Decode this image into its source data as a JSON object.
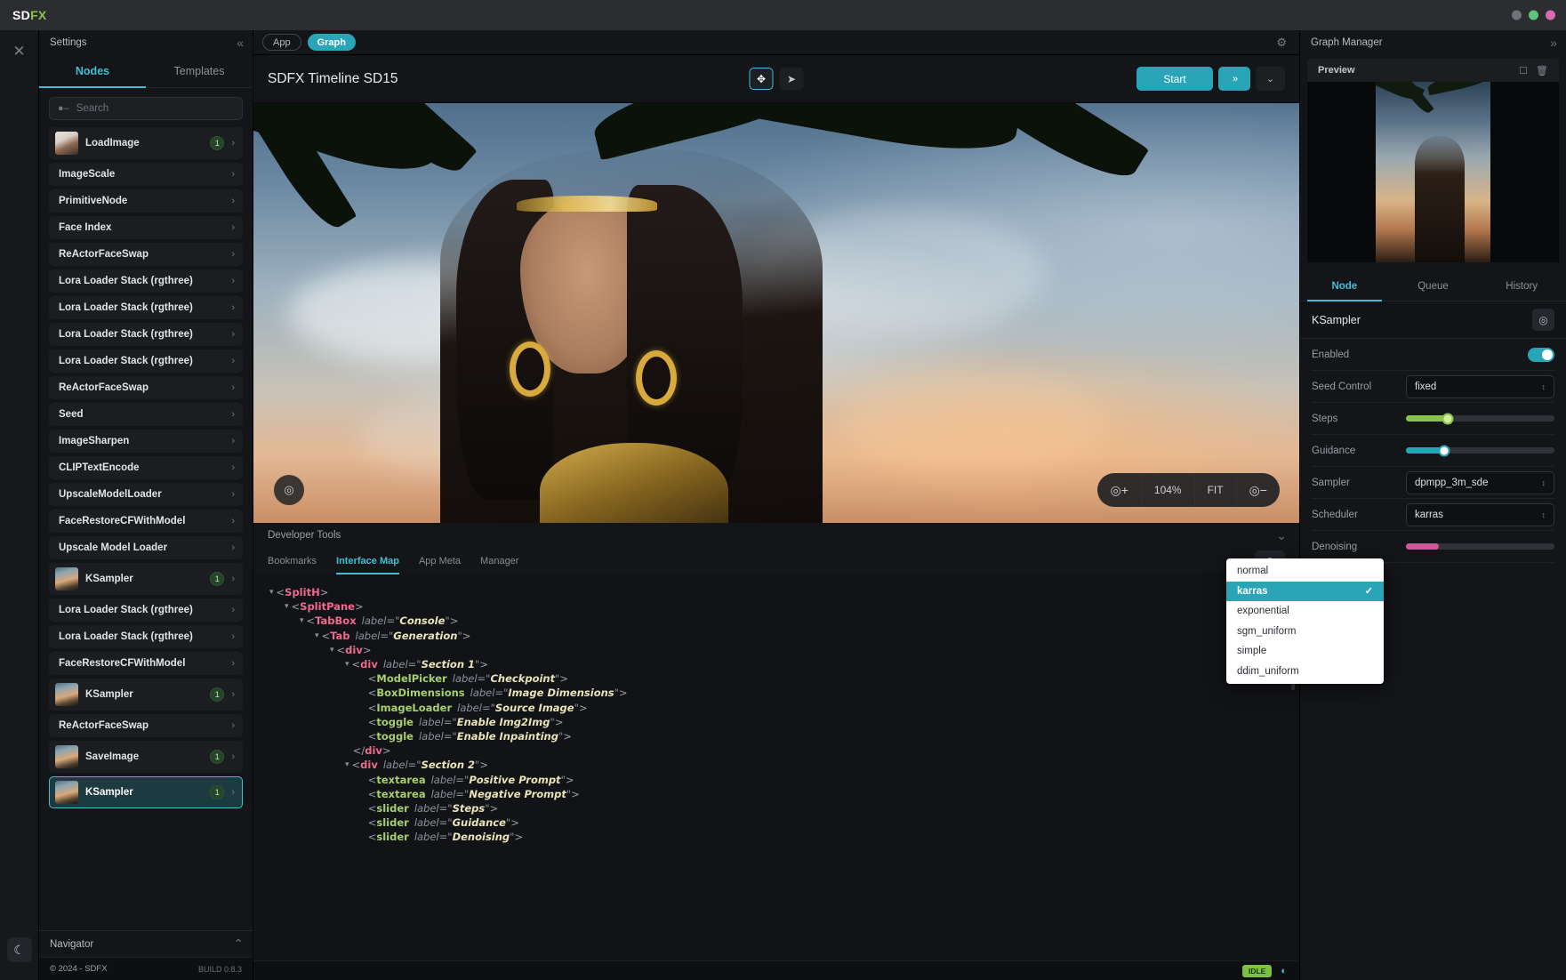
{
  "titlebar": {
    "brand_sd": "SD",
    "brand_fx": "FX"
  },
  "settings": {
    "title": "Settings",
    "tabs": [
      {
        "label": "Nodes"
      },
      {
        "label": "Templates"
      }
    ],
    "search_placeholder": "Search",
    "nodes": [
      {
        "label": "LoadImage",
        "badge": "1",
        "thumb": "face"
      },
      {
        "label": "ImageScale",
        "badge": "",
        "thumb": ""
      },
      {
        "label": "PrimitiveNode",
        "badge": "",
        "thumb": ""
      },
      {
        "label": "Face Index",
        "badge": "",
        "thumb": ""
      },
      {
        "label": "ReActorFaceSwap",
        "badge": "",
        "thumb": ""
      },
      {
        "label": "Lora Loader Stack (rgthree)",
        "badge": "",
        "thumb": ""
      },
      {
        "label": "Lora Loader Stack (rgthree)",
        "badge": "",
        "thumb": ""
      },
      {
        "label": "Lora Loader Stack (rgthree)",
        "badge": "",
        "thumb": ""
      },
      {
        "label": "Lora Loader Stack (rgthree)",
        "badge": "",
        "thumb": ""
      },
      {
        "label": "ReActorFaceSwap",
        "badge": "",
        "thumb": ""
      },
      {
        "label": "Seed",
        "badge": "",
        "thumb": ""
      },
      {
        "label": "ImageSharpen",
        "badge": "",
        "thumb": ""
      },
      {
        "label": "CLIPTextEncode",
        "badge": "",
        "thumb": ""
      },
      {
        "label": "UpscaleModelLoader",
        "badge": "",
        "thumb": ""
      },
      {
        "label": "FaceRestoreCFWithModel",
        "badge": "",
        "thumb": ""
      },
      {
        "label": "Upscale Model Loader",
        "badge": "",
        "thumb": ""
      },
      {
        "label": "KSampler",
        "badge": "1",
        "thumb": "scene"
      },
      {
        "label": "Lora Loader Stack (rgthree)",
        "badge": "",
        "thumb": ""
      },
      {
        "label": "Lora Loader Stack (rgthree)",
        "badge": "",
        "thumb": ""
      },
      {
        "label": "FaceRestoreCFWithModel",
        "badge": "",
        "thumb": ""
      },
      {
        "label": "KSampler",
        "badge": "1",
        "thumb": "scene"
      },
      {
        "label": "ReActorFaceSwap",
        "badge": "",
        "thumb": ""
      },
      {
        "label": "SaveImage",
        "badge": "1",
        "thumb": "scene"
      },
      {
        "label": "KSampler",
        "badge": "1",
        "thumb": "scene",
        "selected": true
      }
    ],
    "navigator_label": "Navigator",
    "copyright": "© 2024 - SDFX",
    "build": "BUILD 0.8.3"
  },
  "center": {
    "tabs": [
      {
        "label": "App",
        "active": false
      },
      {
        "label": "Graph",
        "active": true
      }
    ],
    "canvas_title": "SDFX Timeline SD15",
    "tools": [
      {
        "name": "move-tool",
        "glyph": "✥",
        "active": true
      },
      {
        "name": "pointer-tool",
        "glyph": "➤",
        "active": false
      }
    ],
    "start_label": "Start",
    "queue_more_glyph": "»",
    "dropdown_glyph": "⌄",
    "zoom_percent": "104%",
    "zoom_fit": "FIT"
  },
  "devtools": {
    "title": "Developer Tools",
    "tabs": [
      {
        "label": "Bookmarks",
        "active": false
      },
      {
        "label": "Interface Map",
        "active": true
      },
      {
        "label": "App Meta",
        "active": false
      },
      {
        "label": "Manager",
        "active": false
      }
    ],
    "tree": [
      {
        "indent": 0,
        "caret": true,
        "tag": "SplitH",
        "color": "pink",
        "attr": "",
        "val": "",
        "close": false
      },
      {
        "indent": 1,
        "caret": true,
        "tag": "SplitPane",
        "color": "pink",
        "attr": "",
        "val": "",
        "close": false
      },
      {
        "indent": 2,
        "caret": true,
        "tag": "TabBox",
        "color": "pink",
        "attr": "label",
        "val": "Console",
        "close": false
      },
      {
        "indent": 3,
        "caret": true,
        "tag": "Tab",
        "color": "pink",
        "attr": "label",
        "val": "Generation",
        "close": false
      },
      {
        "indent": 4,
        "caret": true,
        "tag": "div",
        "color": "pink",
        "attr": "",
        "val": "",
        "close": false
      },
      {
        "indent": 5,
        "caret": true,
        "tag": "div",
        "color": "pink",
        "attr": "label",
        "val": "Section 1",
        "close": false
      },
      {
        "indent": 6,
        "caret": false,
        "tag": "ModelPicker",
        "color": "green",
        "attr": "label",
        "val": "Checkpoint",
        "close": false
      },
      {
        "indent": 6,
        "caret": false,
        "tag": "BoxDimensions",
        "color": "green",
        "attr": "label",
        "val": "Image Dimensions",
        "close": false
      },
      {
        "indent": 6,
        "caret": false,
        "tag": "ImageLoader",
        "color": "green",
        "attr": "label",
        "val": "Source Image",
        "close": false
      },
      {
        "indent": 6,
        "caret": false,
        "tag": "toggle",
        "color": "green",
        "attr": "label",
        "val": "Enable Img2Img",
        "close": false
      },
      {
        "indent": 6,
        "caret": false,
        "tag": "toggle",
        "color": "green",
        "attr": "label",
        "val": "Enable Inpainting",
        "close": false
      },
      {
        "indent": 5,
        "caret": false,
        "tag": "div",
        "color": "pink",
        "attr": "",
        "val": "",
        "close": true
      },
      {
        "indent": 5,
        "caret": true,
        "tag": "div",
        "color": "pink",
        "attr": "label",
        "val": "Section 2",
        "close": false
      },
      {
        "indent": 6,
        "caret": false,
        "tag": "textarea",
        "color": "green",
        "attr": "label",
        "val": "Positive Prompt",
        "close": false
      },
      {
        "indent": 6,
        "caret": false,
        "tag": "textarea",
        "color": "green",
        "attr": "label",
        "val": "Negative Prompt",
        "close": false
      },
      {
        "indent": 6,
        "caret": false,
        "tag": "slider",
        "color": "green",
        "attr": "label",
        "val": "Steps",
        "close": false
      },
      {
        "indent": 6,
        "caret": false,
        "tag": "slider",
        "color": "green",
        "attr": "label",
        "val": "Guidance",
        "close": false
      },
      {
        "indent": 6,
        "caret": false,
        "tag": "slider",
        "color": "green",
        "attr": "label",
        "val": "Denoising",
        "close": false
      }
    ]
  },
  "status": {
    "state": "IDLE"
  },
  "graph_manager": {
    "title": "Graph Manager",
    "preview_label": "Preview",
    "tabs": [
      {
        "label": "Node",
        "active": true
      },
      {
        "label": "Queue",
        "active": false
      },
      {
        "label": "History",
        "active": false
      }
    ],
    "node_name": "KSampler",
    "properties": [
      {
        "label": "Enabled",
        "type": "toggle",
        "value": "on"
      },
      {
        "label": "Seed Control",
        "type": "select",
        "value": "fixed"
      },
      {
        "label": "Steps",
        "type": "slider",
        "value": "40",
        "percent": 28,
        "color": "green"
      },
      {
        "label": "Guidance",
        "type": "slider",
        "value": "7.50",
        "percent": 26,
        "color": "cyan"
      },
      {
        "label": "Sampler",
        "type": "select",
        "value": "dpmpp_3m_sde"
      },
      {
        "label": "Scheduler",
        "type": "select",
        "value": "karras"
      },
      {
        "label": "Denoising",
        "type": "slider",
        "value": "",
        "percent": 22,
        "color": "pink"
      }
    ],
    "dropdown": {
      "options": [
        {
          "label": "normal",
          "selected": false
        },
        {
          "label": "karras",
          "selected": true
        },
        {
          "label": "exponential",
          "selected": false
        },
        {
          "label": "sgm_uniform",
          "selected": false
        },
        {
          "label": "simple",
          "selected": false
        },
        {
          "label": "ddim_uniform",
          "selected": false
        }
      ],
      "check_glyph": "✓"
    }
  }
}
